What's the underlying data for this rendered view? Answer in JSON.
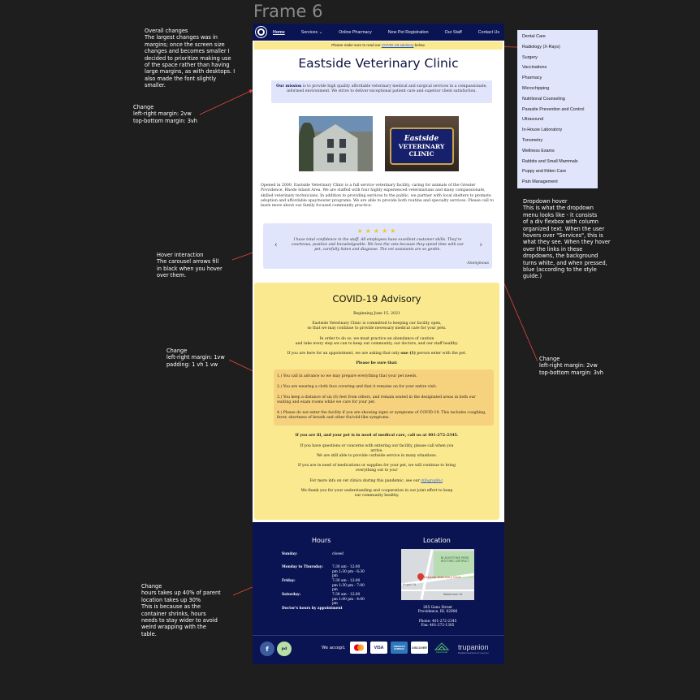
{
  "frame_title": "Frame 6",
  "notes": {
    "overall": {
      "heading": "Overall changes",
      "lines": [
        "The largest changes was in",
        "margins; once the screen size",
        "changes and becomes smaller I",
        "decided to prioritize making use",
        "of the space rather than having",
        "large margins, as with desktops. I",
        "also made the font slightly",
        "smaller."
      ]
    },
    "margin1": {
      "heading": "Change",
      "lines": [
        "left-right margin: 2vw",
        "top-bottom margin: 3vh"
      ]
    },
    "hover": {
      "heading": "Hover interaction",
      "lines": [
        "The carousel arrows fill",
        "in black when you hover",
        "over them."
      ]
    },
    "padding": {
      "heading": "Change",
      "lines": [
        "left-right margin: 1vw",
        "padding: 1 vh 1 vw"
      ]
    },
    "footer_note": {
      "heading": "Change",
      "lines": [
        "hours takes up 40% of parent",
        "location takes up 30%",
        "This is because as the",
        "container shrinks, hours",
        "needs to stay wider to avoid",
        "weird wrapping with the",
        "table."
      ]
    },
    "dropdown_note": {
      "heading": "Dropdown hover",
      "lines": [
        "This is what the dropdown",
        "menu looks like - it consists",
        "of a div flexbox with column",
        "organized text. When the user",
        "hovers over \"Services\", this is",
        "what they see. When they hover",
        "over the links in these",
        "dropdowns, the background",
        "turns white, and when pressed,",
        "blue (according to the style",
        "guide.)"
      ]
    },
    "margin2": {
      "heading": "Change",
      "lines": [
        "left-right margin: 2vw",
        "top-bottom margin: 3vh"
      ]
    }
  },
  "nav": {
    "links": [
      "Home",
      "Services",
      "Online Pharmacy",
      "New Pet Registration",
      "Our Staff",
      "Contact Us"
    ]
  },
  "advisory_bar": {
    "prefix": "Please make sure to read our ",
    "link": "COVID-19 advisory",
    "suffix": " below."
  },
  "clinic_title": "Eastside Veterinary Clinic",
  "mission": {
    "bold": "Our mission",
    "text": " is to provide high quality affordable veterinary medical and surgical services in a compassionate, informed environment. We strive to deliver exceptional patient care and superior client satisfaction."
  },
  "sign_text": [
    "Eastside",
    "VETERINARY",
    "CLINIC"
  ],
  "intro": "Opened in 2000, Eastside Veterinary Clinic is a full service veterinary facility, caring for animals of the Greater Providence, Rhode Island Area. We are staffed with four highly experienced veterinarians and many compassionate, skilled veterinary technicians. In addition to providing services to the public, we partner with local shelters to promote adoption and affordable spay/neuter programs. We are able to provide both routine and specialty services. Please call to learn more about our family focused community practice.",
  "carousel": {
    "stars": "★★★★★",
    "quote": "I have total confidence in the staff. All employees have excellent customer skills. They're courteous, positive and knowledgeable. We love the vets because they spend time with our pet, carefully listen and diagnose. The vet assistants are so gentle.",
    "author": "-Anonymous",
    "prev": "‹",
    "next": "›"
  },
  "covid": {
    "title": "COVID-19 Advisory",
    "date": "Beginning June 15, 2021",
    "p1": [
      "Eastside Veterinary Clinic is committed to keeping our facility open,",
      "so that we may continue to provide necessary medical care for your pets."
    ],
    "p2": [
      "In order to do so, we must practice an abundance of caution",
      "and take every step we can to keep our community, our doctors, and our staff healthy."
    ],
    "p3_pre": "If you are here for an appointment, we are asking that only ",
    "p3_bold": "one (1)",
    "p3_post": " person enter with the pet.",
    "be_sure": "Please be sure that:",
    "list": [
      "1.) You call in advance so we may prepare everything that your pet needs.",
      "2.) You are wearing a cloth face covering and that it remains on for your entire visit.",
      "3.) You keep a distance of six (6) feet from others, and remain seated in the designated areas in both our waiting and exam rooms while we care for your pet.",
      "4.) Please do not enter the facility if you are showing signs or symptoms of COVID-19. This includes coughing, fever, shortness of breath and other flu/cold-like symptoms."
    ],
    "ill": "If you are ill, and your pet is in need of medical care, call us at 401-272-2345.",
    "p4": [
      "If you have questions or concerns with entering our facility, please call when you",
      "arrive.",
      "We are still able to provide curbside service in many situations."
    ],
    "p5": [
      "If you are in need of medications or supplies for your pet, we will continue to bring",
      "everything out to you!"
    ],
    "p6_pre": "For more info on vet clinics during this pandemic, see our ",
    "p6_link": "infographic",
    "p6_post": ".",
    "p7": [
      "We thank you for your understanding and cooperation in our joint effort to keep",
      "our community healthy."
    ]
  },
  "footer": {
    "hours_title": "Hours",
    "location_title": "Location",
    "hours": [
      {
        "day": "Sunday:",
        "time": "closed"
      },
      {
        "day": "Monday to Thursday:",
        "time": "7:30 am - 12:00 pm 1:30 pm - 6:30 pm"
      },
      {
        "day": "Friday:",
        "time": "7:30 am - 12:00 pm 1:30 pm - 7:00 pm"
      },
      {
        "day": "Saturday:",
        "time": "7:30 am - 12:00 pm 1:00 pm - 4:00 pm"
      },
      {
        "day": "Doctor's hours by appointment",
        "time": ""
      }
    ],
    "map_labels": [
      "BLACKSTONE PARK HISTORIC DISTRICT",
      "Eastside Veterinary Clinic",
      "Waterman St",
      "Angell St"
    ],
    "address": [
      "265 Gano Street",
      "Providence, RI, 02906"
    ],
    "phone": "Phone: 401-272-2345",
    "fax": "Fax: 401-272-1305",
    "we_accept": "We accept:",
    "cards": [
      "VISA",
      "AMERICAN EXPRESS",
      "DISCOVER",
      "CareCredit"
    ],
    "trupanion": "trupanion",
    "trupanion_sub": "Medical insurance for your pet"
  },
  "dropdown": {
    "items": [
      "Dental Care",
      "Radiology (X-Rays)",
      "Surgery",
      "Vaccinations",
      "Pharmacy",
      "Microchipping",
      "Nutritional Counseling",
      "Parasite Prevention and Control",
      "Ultrasound",
      "In-House Laboratory",
      "Tonometry",
      "Wellness Exams",
      "Rabbits and Small Mammals",
      "Puppy and Kitten Care",
      "Pain Management"
    ]
  },
  "colors": {
    "navy": "#0b1452",
    "lavender": "#e1e5fb",
    "yellow": "#fbe98f",
    "list_yellow": "#f7d27e",
    "annotation_red": "#e8453c"
  }
}
